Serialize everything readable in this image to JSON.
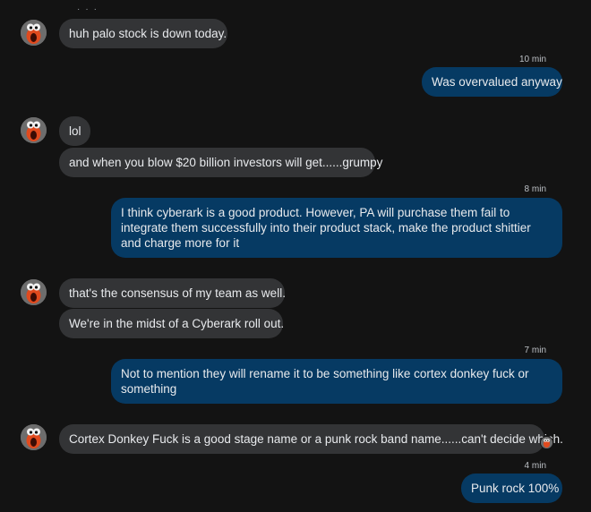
{
  "messages": [
    {
      "id": "m1",
      "dir": "in",
      "text": "huh palo stock is down today."
    },
    {
      "id": "ts1",
      "text": "10 min"
    },
    {
      "id": "m2",
      "dir": "out",
      "text": "Was overvalued anyway"
    },
    {
      "id": "m3",
      "dir": "in",
      "text": "lol"
    },
    {
      "id": "m4",
      "dir": "in",
      "text": "and when you blow $20 billion investors will get......grumpy"
    },
    {
      "id": "ts2",
      "text": "8 min"
    },
    {
      "id": "m5",
      "dir": "out",
      "text": "I think cyberark is a good product. However, PA will purchase them fail to integrate them successfully into their product stack, make the product shittier and charge more for it"
    },
    {
      "id": "m6",
      "dir": "in",
      "text": "that's the consensus of my team as well."
    },
    {
      "id": "m7",
      "dir": "in",
      "text": "We're in the midst of a Cyberark roll out."
    },
    {
      "id": "ts3",
      "text": "7 min"
    },
    {
      "id": "m8",
      "dir": "out",
      "text": "Not to mention they will rename it to be something like cortex donkey fuck or something"
    },
    {
      "id": "m9",
      "dir": "in",
      "text": "Cortex Donkey Fuck is a good stage name or a punk rock band name......can't decide which."
    },
    {
      "id": "ts4",
      "text": "4 min"
    },
    {
      "id": "m10",
      "dir": "out",
      "text": "Punk rock 100%"
    }
  ],
  "labels": {
    "m1": "huh palo stock is down today.",
    "ts1": "10 min",
    "m2": "Was overvalued anyway",
    "m3": "lol",
    "m4": "and when you blow $20 billion investors will get......grumpy",
    "ts2": "8 min",
    "m5": "I think cyberark is a good product. However, PA will purchase them fail to integrate them successfully into their product stack, make the product shittier and charge more for it",
    "m6": "that's the consensus of my team as well.",
    "m7": "We're in the midst of a Cyberark roll out.",
    "ts3": "7 min",
    "m8": "Not to mention they will rename it to be something like cortex donkey fuck or something",
    "m9": "Cortex Donkey Fuck is a good stage name or a punk rock band name......can't decide which.",
    "ts4": "4 min",
    "m10": "Punk rock 100%"
  },
  "colors": {
    "background": "#131313",
    "incoming_bubble": "#333436",
    "outgoing_bubble": "#063a63",
    "text": "#e8eaed",
    "timestamp": "#bdc1c6"
  },
  "icons": {
    "avatar": "contact-avatar-icon",
    "reaction": "reaction-avatar-icon"
  }
}
